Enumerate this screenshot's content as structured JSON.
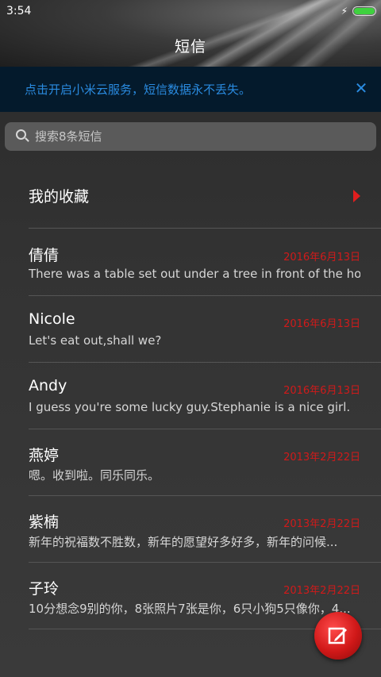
{
  "status_bar": {
    "time": "3:54"
  },
  "header": {
    "title": "短信"
  },
  "banner": {
    "text": "点击开启小米云服务，短信数据永不丢失。",
    "close_icon": "close-icon"
  },
  "search": {
    "placeholder": "搜索8条短信"
  },
  "favorites": {
    "label": "我的收藏"
  },
  "messages": [
    {
      "name": "倩倩",
      "date": "2016年6月13日",
      "preview": "There was a table set out under a tree in front of the ho..."
    },
    {
      "name": "Nicole",
      "date": "2016年6月13日",
      "preview": "Let's eat out,shall we?"
    },
    {
      "name": "Andy",
      "date": "2016年6月13日",
      "preview": "I guess you're some lucky guy.Stephanie is a nice girl."
    },
    {
      "name": "燕婷",
      "date": "2013年2月22日",
      "preview": "嗯。收到啦。同乐同乐。"
    },
    {
      "name": "紫楠",
      "date": "2013年2月22日",
      "preview": "新年的祝福数不胜数，新年的愿望好多好多，新年的问候..."
    },
    {
      "name": "子玲",
      "date": "2013年2月22日",
      "preview": "10分想念9别的你，8张照片7张是你，6只小狗5只像你，4..."
    }
  ],
  "colors": {
    "accent_blue": "#2a8be0",
    "date_red": "#d11a1a",
    "fab_red": "#d01818",
    "battery_green": "#3fd13f"
  }
}
